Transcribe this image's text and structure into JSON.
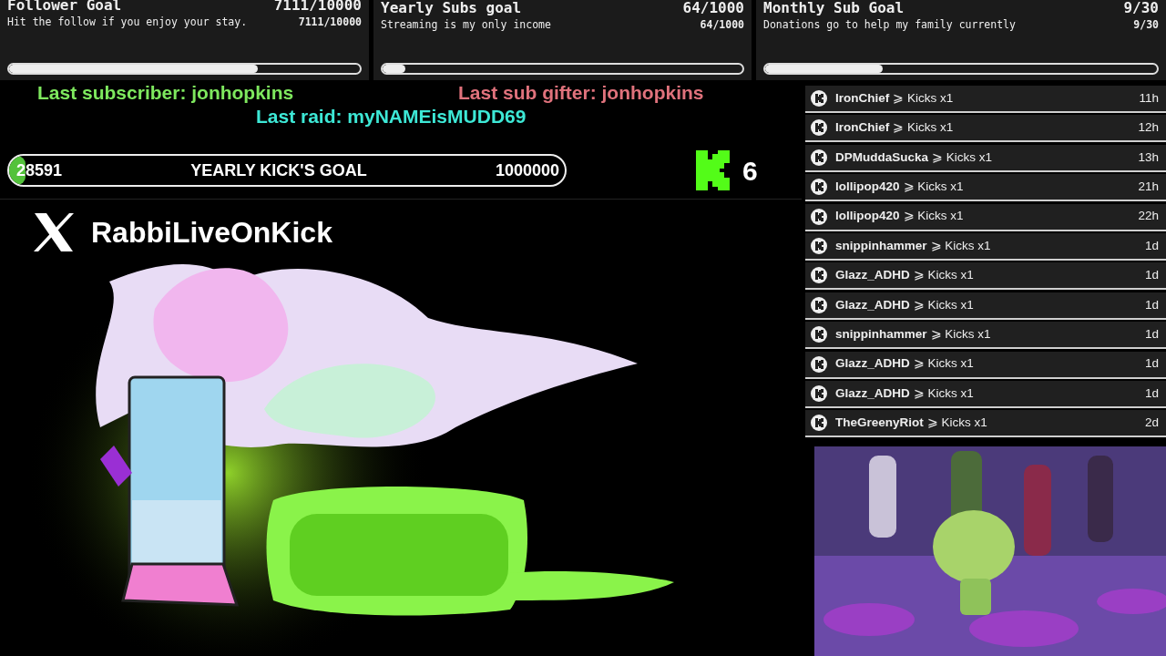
{
  "goals": [
    {
      "title": "Follower Goal",
      "count": "7111/10000",
      "description": "Hit the follow if you enjoy your stay.",
      "count_small": "7111/10000",
      "level": 0.71
    },
    {
      "title": "Yearly Subs goal",
      "count": "64/1000",
      "description": "Streaming is my only income",
      "count_small": "64/1000",
      "level": 0.064
    },
    {
      "title": "Monthly Sub Goal",
      "count": "9/30",
      "description": "Donations go to help my family currently",
      "count_small": "9/30",
      "level": 0.3
    }
  ],
  "last_events": [
    {
      "text": "Last subscriber: jonhopkins",
      "color": "#7ee85e"
    },
    {
      "text": "Last sub gifter: jonhopkins",
      "color": "#e0727c"
    },
    {
      "text": "Last raid: myNAMEisMUDD69",
      "color": "#3de8d6"
    }
  ],
  "kick_goal": {
    "current": "28591",
    "title": "YEARLY KICK'S GOAL",
    "target": "1000000",
    "level": 0.03
  },
  "viewer_count": "6",
  "social": {
    "handle": "RabbiLiveOnKick"
  },
  "kicks_feed": [
    {
      "user": "IronChief",
      "action": "⩾ Kicks x1",
      "time": "11h"
    },
    {
      "user": "IronChief",
      "action": "⩾ Kicks x1",
      "time": "12h"
    },
    {
      "user": "DPMuddaSucka",
      "action": "⩾ Kicks x1",
      "time": "13h"
    },
    {
      "user": "lollipop420",
      "action": "⩾ Kicks x1",
      "time": "21h"
    },
    {
      "user": "lollipop420",
      "action": "⩾ Kicks x1",
      "time": "22h"
    },
    {
      "user": "snippinhammer",
      "action": "⩾ Kicks x1",
      "time": "1d"
    },
    {
      "user": "Glazz_ADHD",
      "action": "⩾ Kicks x1",
      "time": "1d"
    },
    {
      "user": "Glazz_ADHD",
      "action": "⩾ Kicks x1",
      "time": "1d"
    },
    {
      "user": "snippinhammer",
      "action": "⩾ Kicks x1",
      "time": "1d"
    },
    {
      "user": "Glazz_ADHD",
      "action": "⩾ Kicks x1",
      "time": "1d"
    },
    {
      "user": "Glazz_ADHD",
      "action": "⩾ Kicks x1",
      "time": "1d"
    },
    {
      "user": "TheGreenyRiot",
      "action": "⩾ Kicks x1",
      "time": "2d"
    }
  ]
}
